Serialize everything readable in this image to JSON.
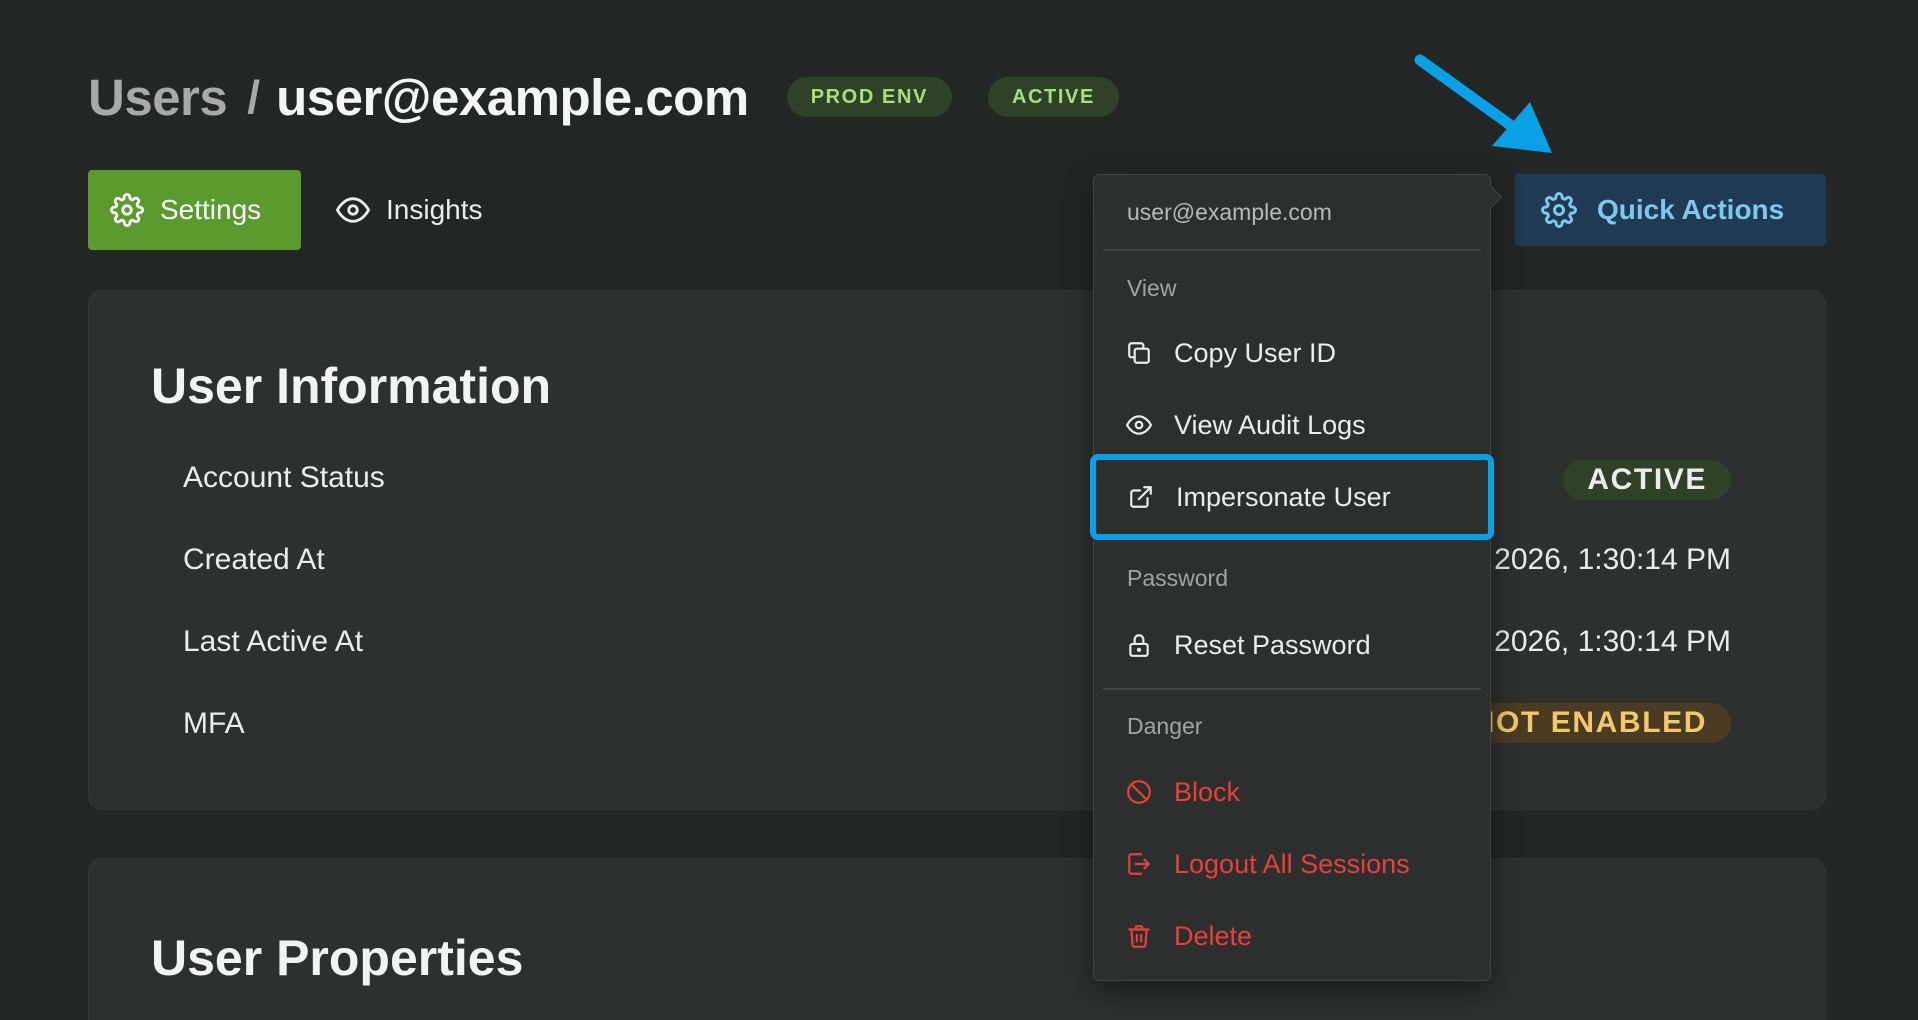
{
  "breadcrumb": {
    "parent": "Users",
    "separator": "/",
    "current": "user@example.com"
  },
  "header_badges": [
    "PROD ENV",
    "ACTIVE"
  ],
  "tabs": [
    {
      "label": "Settings",
      "icon": "gear-icon",
      "active": true
    },
    {
      "label": "Insights",
      "icon": "eye-icon",
      "active": false
    }
  ],
  "quick_actions": {
    "label": "Quick Actions",
    "icon": "gear-icon"
  },
  "user_information": {
    "title": "User Information",
    "rows": [
      {
        "label": "Account Status",
        "value": "ACTIVE"
      },
      {
        "label": "Created At",
        "value": "2026, 1:30:14 PM"
      },
      {
        "label": "Last Active At",
        "value": "2026, 1:30:14 PM"
      },
      {
        "label": "MFA",
        "value": "NOT ENABLED"
      }
    ]
  },
  "user_properties": {
    "title": "User Properties"
  },
  "menu": {
    "email": "user@example.com",
    "sections": [
      {
        "title": "View",
        "items": [
          {
            "label": "Copy User ID",
            "icon": "copy-icon"
          },
          {
            "label": "View Audit Logs",
            "icon": "eye-icon"
          },
          {
            "label": "Impersonate User",
            "icon": "external-link-icon",
            "highlighted": true
          }
        ]
      },
      {
        "title": "Password",
        "items": [
          {
            "label": "Reset Password",
            "icon": "lock-icon"
          }
        ]
      },
      {
        "title": "Danger",
        "items": [
          {
            "label": "Block",
            "icon": "ban-icon"
          },
          {
            "label": "Logout All Sessions",
            "icon": "logout-icon"
          },
          {
            "label": "Delete",
            "icon": "trash-icon"
          }
        ]
      }
    ]
  },
  "colors": {
    "background": "#242525",
    "card": "#2e3030",
    "settings_tab": "#5b9a2f",
    "quick_actions_bg": "#1f3a52",
    "quick_actions_text": "#7ec8f0",
    "badge_green_bg": "#2f4228",
    "badge_green_text": "#a5e07b",
    "badge_warn_bg": "#4b3b22",
    "badge_warn_text": "#f1c86a",
    "danger": "#e5413a",
    "highlight": "#0aa0e6"
  }
}
